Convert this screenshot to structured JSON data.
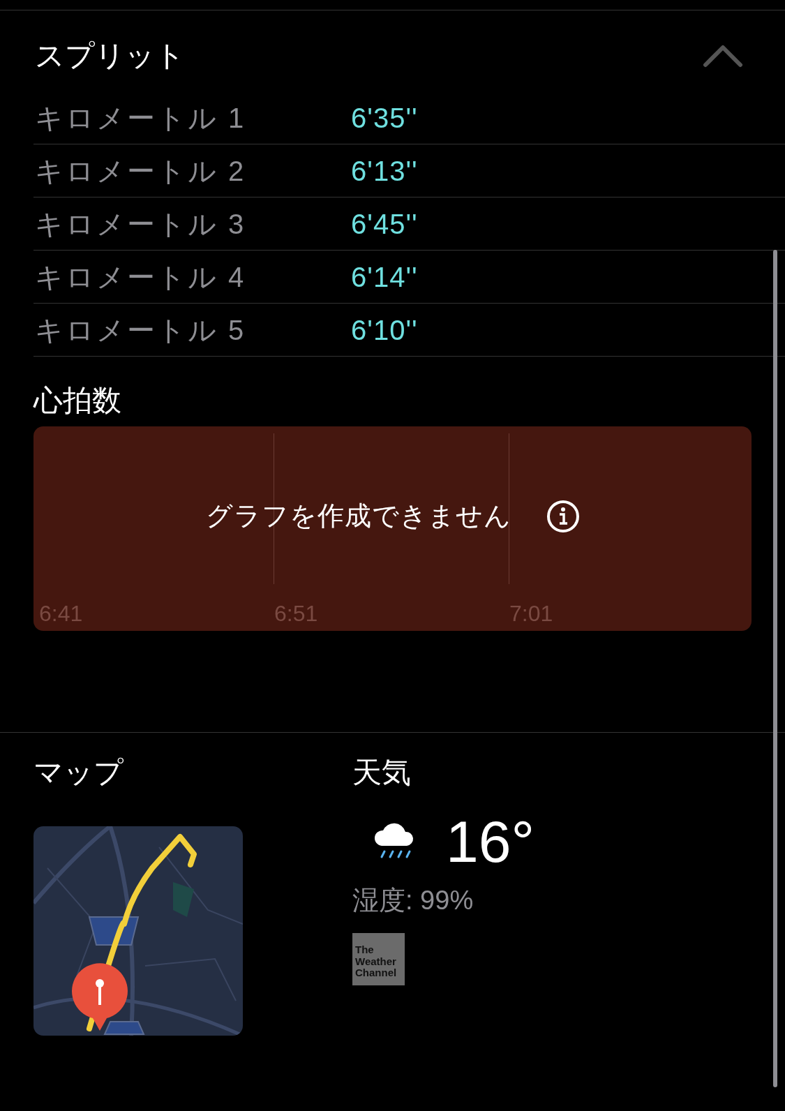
{
  "splits": {
    "title": "スプリット",
    "expanded": true,
    "rows": [
      {
        "label": "キロメートル 1",
        "pace": "6'35''"
      },
      {
        "label": "キロメートル 2",
        "pace": "6'13''"
      },
      {
        "label": "キロメートル 3",
        "pace": "6'45''"
      },
      {
        "label": "キロメートル 4",
        "pace": "6'14''"
      },
      {
        "label": "キロメートル 5",
        "pace": "6'10''"
      }
    ]
  },
  "heart_rate": {
    "title": "心拍数",
    "message": "グラフを作成できません",
    "time_labels": [
      "6:41",
      "6:51",
      "7:01"
    ]
  },
  "map": {
    "title": "マップ",
    "kind": "picture"
  },
  "weather": {
    "title": "天気",
    "temperature": "16°",
    "humidity": "湿度: 99%",
    "provider_logo": "The Weather Channel"
  }
}
